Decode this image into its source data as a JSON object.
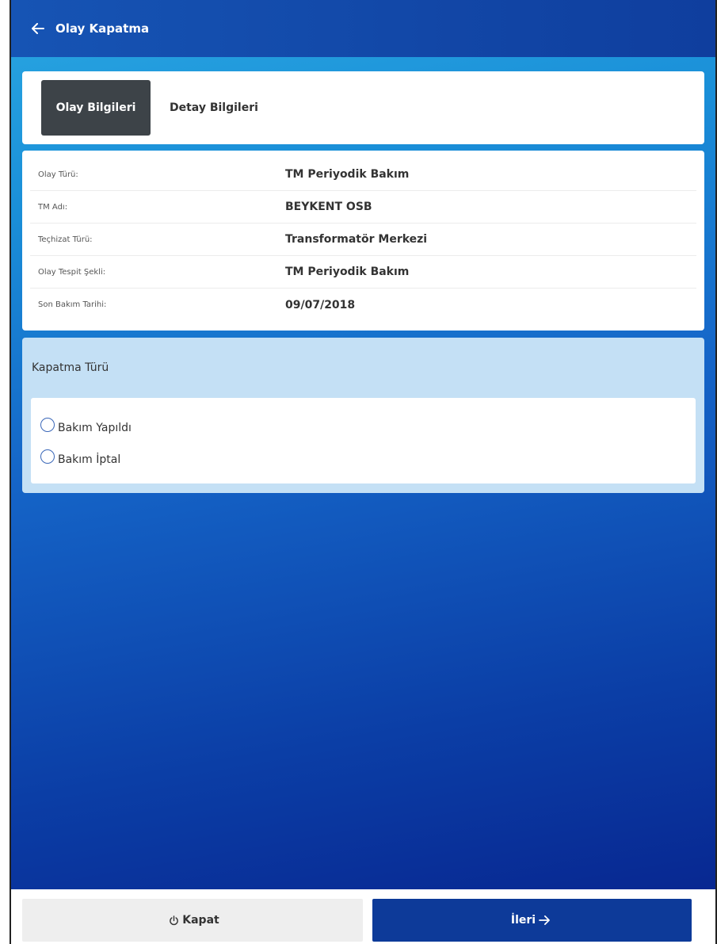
{
  "header": {
    "back_icon": "arrow-left-icon",
    "title": "Olay Kapatma"
  },
  "tabs": [
    {
      "label": "Olay Bilgileri",
      "active": true
    },
    {
      "label": "Detay Bilgileri",
      "active": false
    }
  ],
  "info": {
    "rows": [
      {
        "label": "Olay Türü:",
        "value": "TM Periyodik Bakım"
      },
      {
        "label": "TM Adı:",
        "value": "BEYKENT OSB"
      },
      {
        "label": "Teçhizat Türü:",
        "value": "Transformatör Merkezi"
      },
      {
        "label": "Olay Tespit Şekli:",
        "value": "TM Periyodik Bakım"
      },
      {
        "label": "Son Bakım Tarihi:",
        "value": "09/07/2018"
      }
    ]
  },
  "closing": {
    "title": "Kapatma Türü",
    "options": [
      {
        "label": "Bakım Yapıldı",
        "selected": false
      },
      {
        "label": "Bakım İptal",
        "selected": false
      }
    ]
  },
  "footer": {
    "close_label": "Kapat",
    "close_icon": "power-icon",
    "next_label": "İleri",
    "next_icon": "arrow-right-icon"
  },
  "colors": {
    "header": "#0f3e9e",
    "tab_active": "#3d4348",
    "panel": "#c4e0f5",
    "primary_button": "#0d3a99"
  }
}
